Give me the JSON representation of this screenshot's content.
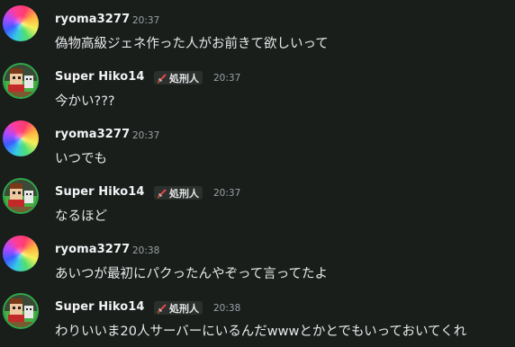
{
  "messages": [
    {
      "author": "ryoma3277",
      "timestamp": "20:37",
      "text": "偽物高級ジェネ作った人がお前きて欲しいって"
    },
    {
      "author": "Super Hiko14",
      "role": "処刑人",
      "timestamp": "20:37",
      "text": "今かい???"
    },
    {
      "author": "ryoma3277",
      "timestamp": "20:37",
      "text": "いつでも"
    },
    {
      "author": "Super Hiko14",
      "role": "処刑人",
      "timestamp": "20:37",
      "text": "なるほど"
    },
    {
      "author": "ryoma3277",
      "timestamp": "20:38",
      "text": "あいつが最初にパクったんやぞって言ってたよ"
    },
    {
      "author": "Super Hiko14",
      "role": "処刑人",
      "timestamp": "20:38",
      "text": "わりいいま20人サーバーにいるんだwwwとかとでもいっておいてくれ"
    }
  ],
  "colors": {
    "background": "#1a1e1b",
    "username": "#f2f3f5",
    "timestamp": "#9aa0a6",
    "role_badge_bg": "#2b302d",
    "avatar_border": "#2fa84a"
  },
  "icons": {
    "role": "sword-icon"
  }
}
